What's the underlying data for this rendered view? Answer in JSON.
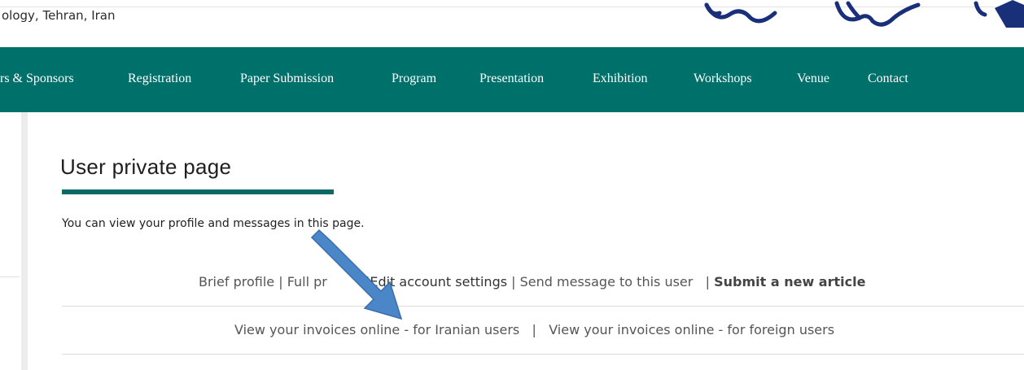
{
  "header": {
    "institution": "ology, Tehran, Iran"
  },
  "nav": {
    "items": [
      {
        "label": "rs & Sponsors"
      },
      {
        "label": "Registration"
      },
      {
        "label": "Paper Submission"
      },
      {
        "label": "Program"
      },
      {
        "label": "Presentation"
      },
      {
        "label": "Exhibition"
      },
      {
        "label": "Workshops"
      },
      {
        "label": "Venue"
      },
      {
        "label": "Contact"
      }
    ],
    "bg_color": "#00706b"
  },
  "page": {
    "title": "User private page",
    "intro": "You can view your profile and messages in this page.",
    "links": {
      "brief_profile": "Brief profile",
      "full_profile": "Full pr",
      "edit_account": "Edit account settings",
      "send_message": "Send message to this user",
      "submit_article": "Submit a new article",
      "invoices_iranian": "View your invoices online - for Iranian users",
      "invoices_foreign": "View your invoices online - for foreign users",
      "separator": "|"
    }
  },
  "annotation": {
    "icon": "arrow-icon",
    "color": "#4a86c8"
  }
}
